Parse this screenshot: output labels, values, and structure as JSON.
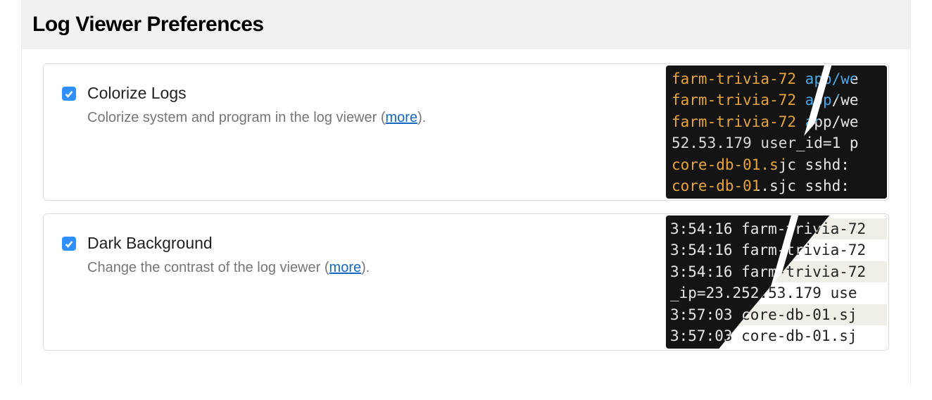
{
  "section_title": "Log Viewer Preferences",
  "prefs": [
    {
      "checked": true,
      "title": "Colorize Logs",
      "desc_pre": "Colorize system and program in the log viewer (",
      "more": "more",
      "desc_post": ")."
    },
    {
      "checked": true,
      "title": "Dark Background",
      "desc_pre": "Change the contrast of the log viewer (",
      "more": "more",
      "desc_post": ")."
    }
  ],
  "preview_colorize": {
    "lines": [
      {
        "host": "farm-trivia-72",
        "proc": "app/we"
      },
      {
        "host": "farm-trivia-72",
        "proc": "app/we"
      },
      {
        "host": "farm-trivia-72",
        "proc": "app/we"
      }
    ],
    "mid": "52.53.179 user_id=1 p",
    "tail": [
      {
        "host": "core-db-01.sjc",
        "proc": "sshd:"
      },
      {
        "host": "core-db-01.sjc",
        "proc": "sshd:"
      }
    ]
  },
  "preview_darkbg": {
    "lines": [
      "3:54:16 farm-trivia-72",
      "3:54:16 farm-trivia-72",
      "3:54:16 farm-trivia-72",
      "_ip=23.252.53.179 use",
      "3:57:03 core-db-01.sj",
      "3:57:03 core-db-01.sj"
    ]
  }
}
